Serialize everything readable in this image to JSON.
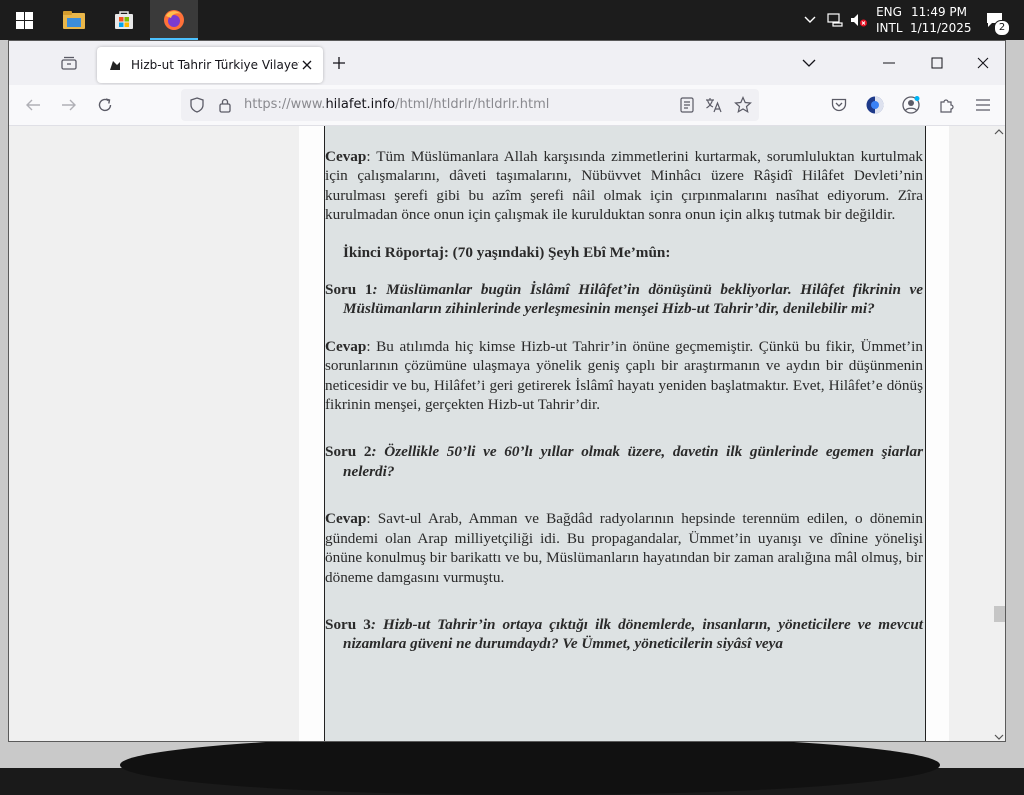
{
  "taskbar": {
    "apps": [
      "file-explorer",
      "microsoft-store",
      "firefox"
    ],
    "language": "ENG",
    "language_sub": "INTL",
    "time": "11:49 PM",
    "date": "1/11/2025",
    "notification_count": "2"
  },
  "browser": {
    "tab_title": "Hizb-ut Tahrir Türkiye Vilayeti R",
    "url_prefix": "https://www.",
    "url_host": "hilafet.info",
    "url_path": "/html/htldrlr/htldrlr.html"
  },
  "document": {
    "a1_label": "Cevap",
    "a1_text": ": Tüm Müslümanlara Allah karşısında zimmetlerini kurtarmak, sorumluluktan kurtulmak için çalışmalarını, dâveti taşımalarını, Nübüvvet Minhâcı üzere Râşidî Hilâfet Devleti’nin kurulması şerefi gibi bu azîm şerefi nâil olmak için çırpınmalarını nasîhat ediyorum. Zîra kurulmadan önce onun için çalışmak ile kurulduktan sonra onun için alkış tutmak bir değildir.",
    "heading": "İkinci Röportaj: (70 yaşındaki) Şeyh Ebî Me’mûn:",
    "q1_label": "Soru 1",
    "q1_text": ": Müslümanlar bugün İslâmî Hilâfet’in dönüşünü bekliyorlar. Hilâfet fikrinin ve Müslümanların zihinlerinde yerleşmesinin menşei Hizb-ut Tahrir’dir, denilebilir mi?",
    "a2_label": "Cevap",
    "a2_text": ": Bu atılımda hiç kimse Hizb-ut Tahrir’in önüne geçmemiştir. Çünkü bu fikir, Ümmet’in sorunlarının çözümüne ulaşmaya yönelik geniş çaplı bir araştırmanın ve aydın bir düşünmenin neticesidir ve bu, Hilâfet’i geri getirerek İslâmî hayatı yeniden başlatmaktır. Evet, Hilâfet’e dönüş fikrinin menşei, gerçekten Hizb-ut Tahrir’dir.",
    "q2_label": "Soru 2",
    "q2_text": ": Özellikle 50’li ve 60’lı yıllar olmak üzere, davetin ilk günlerinde egemen şiarlar nelerdi?",
    "a3_label": "Cevap",
    "a3_text": ": Savt-ul Arab, Amman ve Bağdâd radyolarının hepsinde terennüm edilen, o dönemin gündemi olan Arap milliyetçiliği idi. Bu propagandalar, Ümmet’in uyanışı ve dînine yönelişi önüne konulmuş bir barikattı ve bu, Müslümanların hayatından bir zaman aralığına mâl olmuş, bir döneme damgasını vurmuştu.",
    "q3_label": "Soru 3",
    "q3_text": ": Hizb-ut Tahrir’in ortaya çıktığı ilk dönemlerde, insanların, yöneticilere ve mevcut nizamlara güveni ne durumdaydı? Ve Ümmet, yöneticilerin siyâsî veya"
  }
}
